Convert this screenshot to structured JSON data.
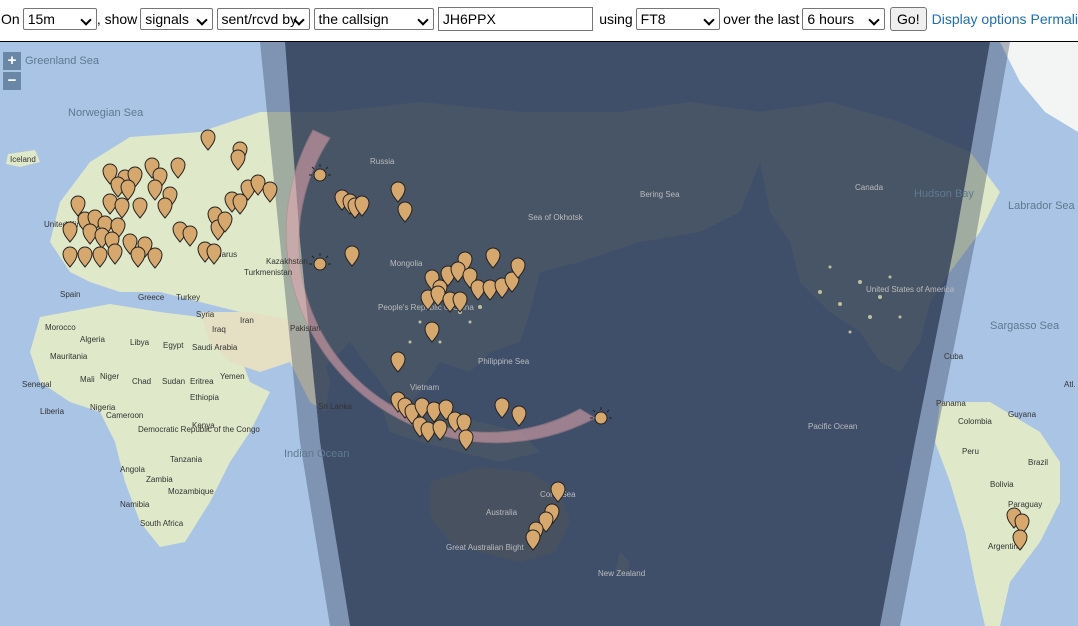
{
  "toolbar": {
    "prefix": "On",
    "band": "15m",
    "show_label": ", show",
    "show_value": "signals",
    "direction": "sent/rcvd by",
    "target": "the callsign",
    "callsign": "JH6PPX",
    "using_label": "using",
    "mode": "FT8",
    "over_label": "over the last",
    "period": "6 hours",
    "go_label": "Go!",
    "display_options_link": "Display options",
    "permalink_link": "Permali"
  },
  "map": {
    "zoom_in": "+",
    "zoom_out": "−",
    "sea_labels": [
      "Greenland Sea",
      "Norwegian Sea",
      "Sea of Okhotsk",
      "Philippine Sea",
      "Indian Ocean",
      "Pacific Ocean",
      "Coral Sea",
      "Hudson Bay",
      "Labrador Sea",
      "Sargasso Sea",
      "Bering Sea"
    ],
    "land_labels": [
      "Iceland",
      "United Kingdom",
      "Spain",
      "Morocco",
      "Algeria",
      "Libya",
      "Egypt",
      "Mauritania",
      "Mali",
      "Niger",
      "Chad",
      "Sudan",
      "Eritrea",
      "Senegal",
      "Liberia",
      "Nigeria",
      "Cameroon",
      "Ethiopia",
      "Kenya",
      "Democratic Republic of the Congo",
      "Tanzania",
      "Angola",
      "Zambia",
      "Mozambique",
      "Namibia",
      "South Africa",
      "Greece",
      "Turkey",
      "Syria",
      "Iraq",
      "Iran",
      "Saudi Arabia",
      "Yemen",
      "Turkmenistan",
      "Pakistan",
      "Kazakhstan",
      "Mongolia",
      "Russia",
      "Belarus",
      "People's Republic of China",
      "Vietnam",
      "Sri Lanka",
      "Australia",
      "Great Australian Bight",
      "New Zealand",
      "Canada",
      "United States of America",
      "Cuba",
      "Panama",
      "Colombia",
      "Guyana",
      "Peru",
      "Brazil",
      "Bolivia",
      "Paraguay",
      "Argentina",
      "Atl. O"
    ]
  },
  "colors": {
    "ocean": "#a9c4e4",
    "land": "#dfe8c9",
    "night": "#2d3b55",
    "pin": "#d7a86e",
    "ring": "#e8a8b0"
  }
}
